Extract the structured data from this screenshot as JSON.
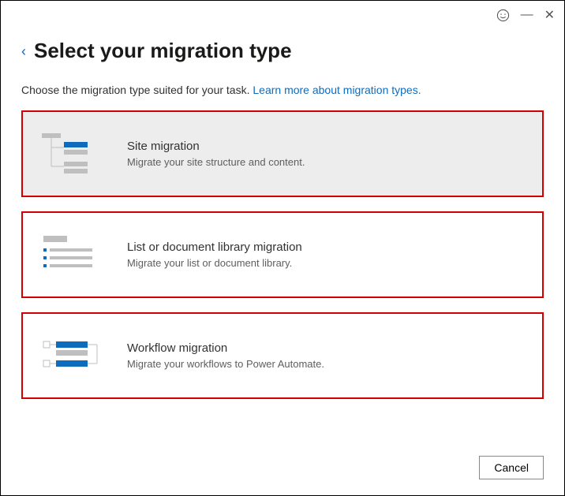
{
  "titlebar": {
    "feedback_icon": "☺",
    "minimize": "—",
    "close": "✕"
  },
  "header": {
    "back": "‹",
    "title": "Select your migration type"
  },
  "subtext": {
    "prefix": "Choose the migration type suited for your task. ",
    "link": "Learn more about migration types."
  },
  "cards": [
    {
      "title": "Site migration",
      "desc": "Migrate your site structure and content."
    },
    {
      "title": "List or document library migration",
      "desc": "Migrate your list or document library."
    },
    {
      "title": "Workflow migration",
      "desc": "Migrate your workflows to Power Automate."
    }
  ],
  "footer": {
    "cancel": "Cancel"
  }
}
